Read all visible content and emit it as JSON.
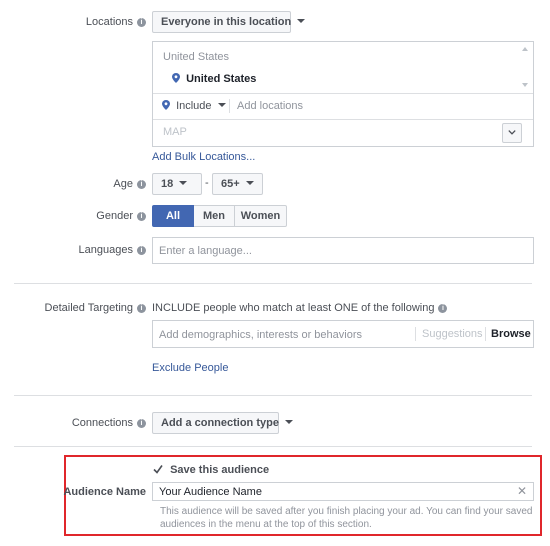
{
  "locations": {
    "label": "Locations",
    "dropdown": "Everyone in this location",
    "country_header": "United States",
    "selected_location": "United States",
    "include_label": "Include",
    "add_placeholder": "Add locations",
    "map_label": "MAP",
    "bulk_link": "Add Bulk Locations..."
  },
  "age": {
    "label": "Age",
    "min": "18",
    "separator": "-",
    "max": "65+"
  },
  "gender": {
    "label": "Gender",
    "options": [
      "All",
      "Men",
      "Women"
    ],
    "selected": "All"
  },
  "languages": {
    "label": "Languages",
    "placeholder": "Enter a language..."
  },
  "detailed_targeting": {
    "label": "Detailed Targeting",
    "description": "INCLUDE people who match at least ONE of the following",
    "placeholder": "Add demographics, interests or behaviors",
    "suggestions": "Suggestions",
    "browse": "Browse",
    "exclude_link": "Exclude People"
  },
  "connections": {
    "label": "Connections",
    "dropdown": "Add a connection type"
  },
  "audience": {
    "save_label": "Save this audience",
    "save_checked": true,
    "name_label": "Audience Name",
    "name_value": "Your Audience Name",
    "help_text_line1": "This audience will be saved after you finish placing your ad. You can find your saved",
    "help_text_line2": "audiences in the menu at the top of this section."
  },
  "colors": {
    "accent": "#4267b2",
    "link": "#365899",
    "highlight_border": "#e0262b"
  }
}
